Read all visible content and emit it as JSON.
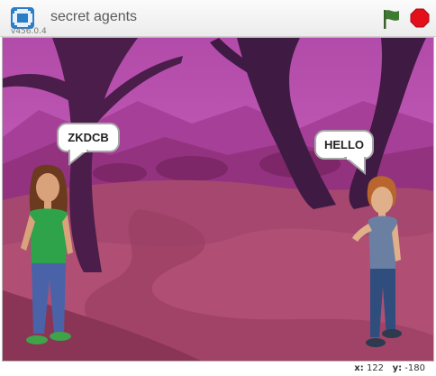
{
  "project": {
    "title": "secret agents",
    "version": "v456.0.4"
  },
  "controls": {
    "fullscreen_icon": "fullscreen-icon",
    "flag_icon": "green-flag-icon",
    "stop_icon": "stop-sign-icon"
  },
  "speech": {
    "left_text": "ZKDCB",
    "right_text": "HELLO"
  },
  "coords": {
    "x_label": "x:",
    "x_value": "122",
    "y_label": "y:",
    "y_value": "-180"
  },
  "colors": {
    "flag": "#3f7a35",
    "stop": "#e3101c",
    "fullscreen": "#2a7dc7",
    "sky": "#b24ba9"
  }
}
